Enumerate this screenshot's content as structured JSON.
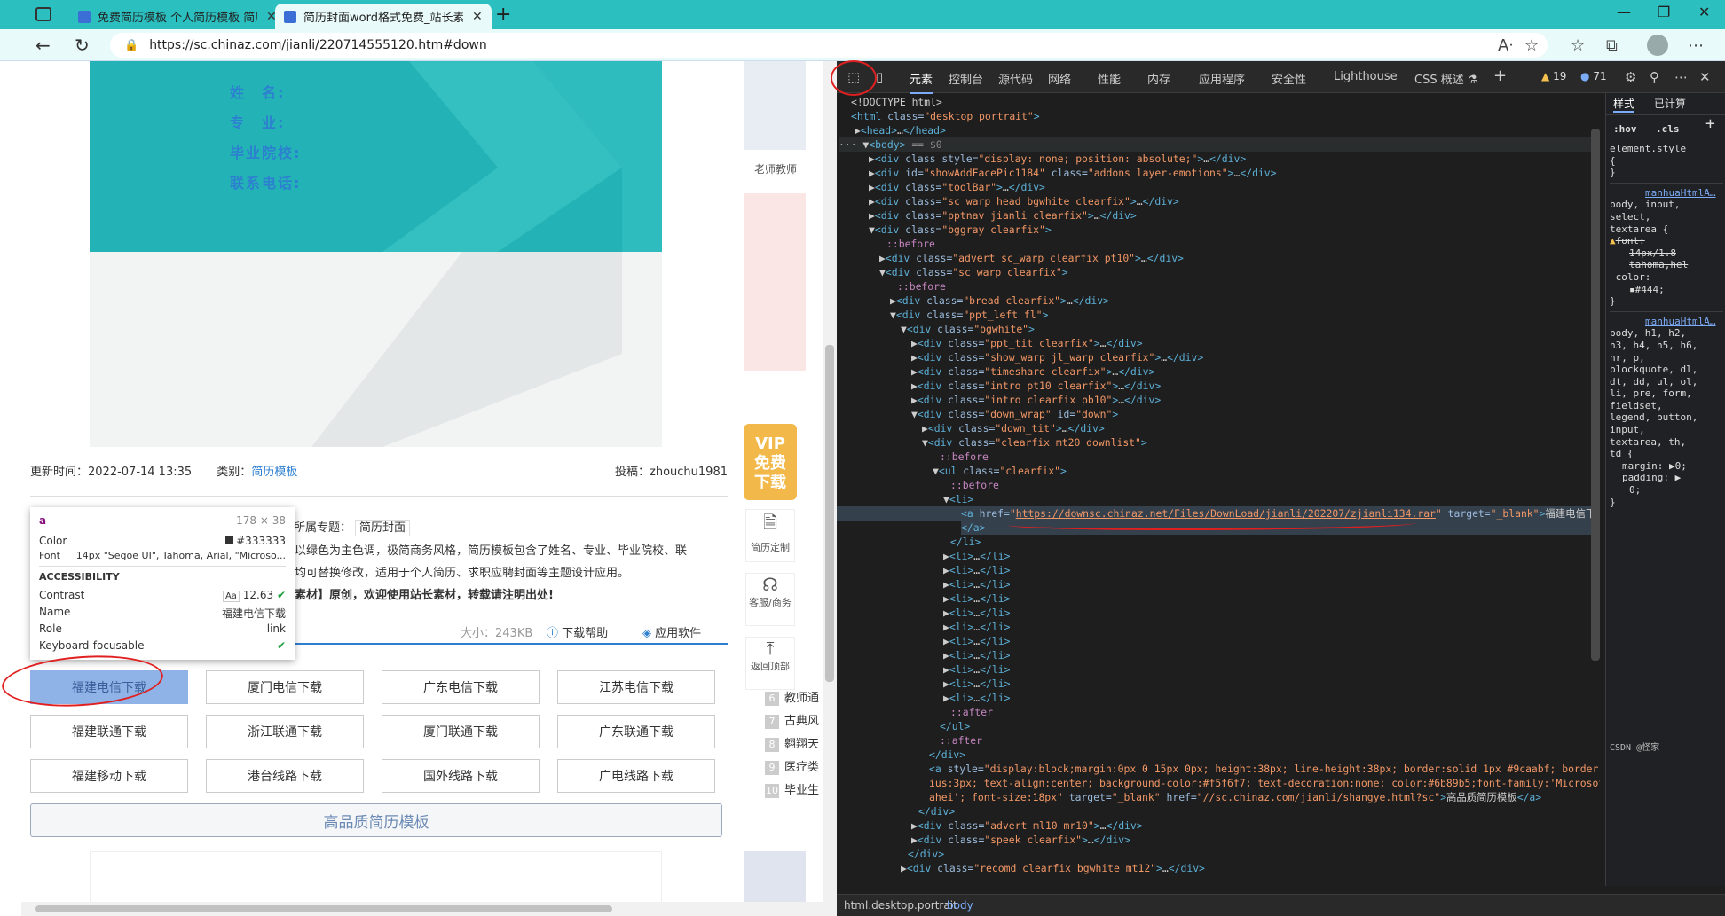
{
  "tabs": [
    {
      "title": "免费简历模板 个人简历模板 简历"
    },
    {
      "title": "简历封面word格式免费_站长素材"
    }
  ],
  "address": {
    "url": "https://sc.chinaz.com/jianli/220714555120.htm#down"
  },
  "hero": {
    "fields": [
      "姓　名:",
      "专　业:",
      "毕业院校:",
      "联系电话:"
    ]
  },
  "meta": {
    "update_label": "更新时间：2022-07-14 13:35",
    "category_label": "类别：",
    "category_link": "简历模板",
    "uploader": "投稿：zhouchu1981",
    "topic_label": "所属专题：",
    "topic_value": "简历封面",
    "desc1": "以绿色为主色调，极简商务风格，简历模板包含了姓名、专业、毕业院校、联",
    "desc2": "均可替换修改，适用于个人简历、求职应聘封面等主题设计应用。",
    "desc3": "素材】原创，欢迎使用站长素材，转载请注明出处!",
    "size": "大小：243KB",
    "help": "下载帮助",
    "app": "应用软件"
  },
  "downloads": [
    [
      "福建电信下载",
      "厦门电信下载",
      "广东电信下载",
      "江苏电信下载"
    ],
    [
      "福建联通下载",
      "浙江联通下载",
      "厦门联通下载",
      "广东联通下载"
    ],
    [
      "福建移动下载",
      "港台线路下载",
      "国外线路下载",
      "广电线路下载"
    ]
  ],
  "quality_link": "高品质简历模板",
  "tooltip": {
    "tag": "a",
    "dims": "178 × 38",
    "color_label": "Color",
    "color_value": "#333333",
    "font_label": "Font",
    "font_value": "14px \"Segoe UI\", Tahoma, Arial, \"Microso...",
    "section": "ACCESSIBILITY",
    "contrast_label": "Contrast",
    "contrast_value": "12.63",
    "name_label": "Name",
    "name_value": "福建电信下载",
    "role_label": "Role",
    "role_value": "link",
    "kbd_label": "Keyboard-focusable"
  },
  "sidebar": {
    "teacher": "老师教师",
    "vip1": "VIP",
    "vip2": "免费",
    "vip3": "下载",
    "custom": "简历定制",
    "service": "客服/商务",
    "top": "返回顶部",
    "ranks": [
      {
        "n": "6",
        "t": "教师通"
      },
      {
        "n": "7",
        "t": "古典风"
      },
      {
        "n": "8",
        "t": "翱翔天"
      },
      {
        "n": "9",
        "t": "医疗类"
      },
      {
        "n": "10",
        "t": "毕业生"
      }
    ]
  },
  "devtools": {
    "tabs": [
      "元素",
      "控制台",
      "源代码",
      "网络",
      "性能",
      "内存",
      "应用程序",
      "安全性",
      "Lighthouse",
      "CSS 概述 ⚗"
    ],
    "warnings": "19",
    "issues": "71",
    "styles_tabs": [
      "样式",
      "已计算"
    ],
    "hov": ":hov",
    "cls": ".cls",
    "crumbs": [
      "html.desktop.portrait",
      "body"
    ],
    "watermark": "CSDN @怪家"
  }
}
